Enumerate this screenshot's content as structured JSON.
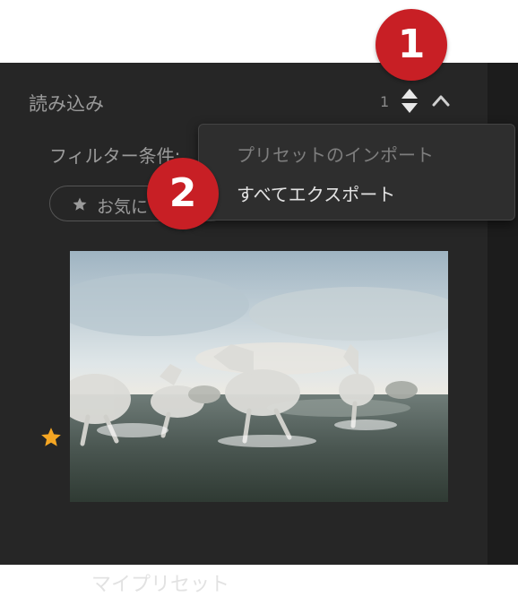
{
  "annotations": {
    "badge_1": "1",
    "badge_2": "2"
  },
  "section": {
    "title": "読み込み",
    "count": "1"
  },
  "filter": {
    "label": "フィルター条件:",
    "favorite_chip": "お気に"
  },
  "menu": {
    "items": [
      {
        "label": "プリセットのインポート",
        "enabled": false
      },
      {
        "label": "すべてエクスポート",
        "enabled": true
      }
    ]
  },
  "preset": {
    "name": "マイプリセット",
    "favorite": true,
    "thumbnail": "white horses running through water"
  },
  "colors": {
    "panel_bg": "#262626",
    "badge": "#c81f25",
    "favorite_star": "#f5a623"
  }
}
